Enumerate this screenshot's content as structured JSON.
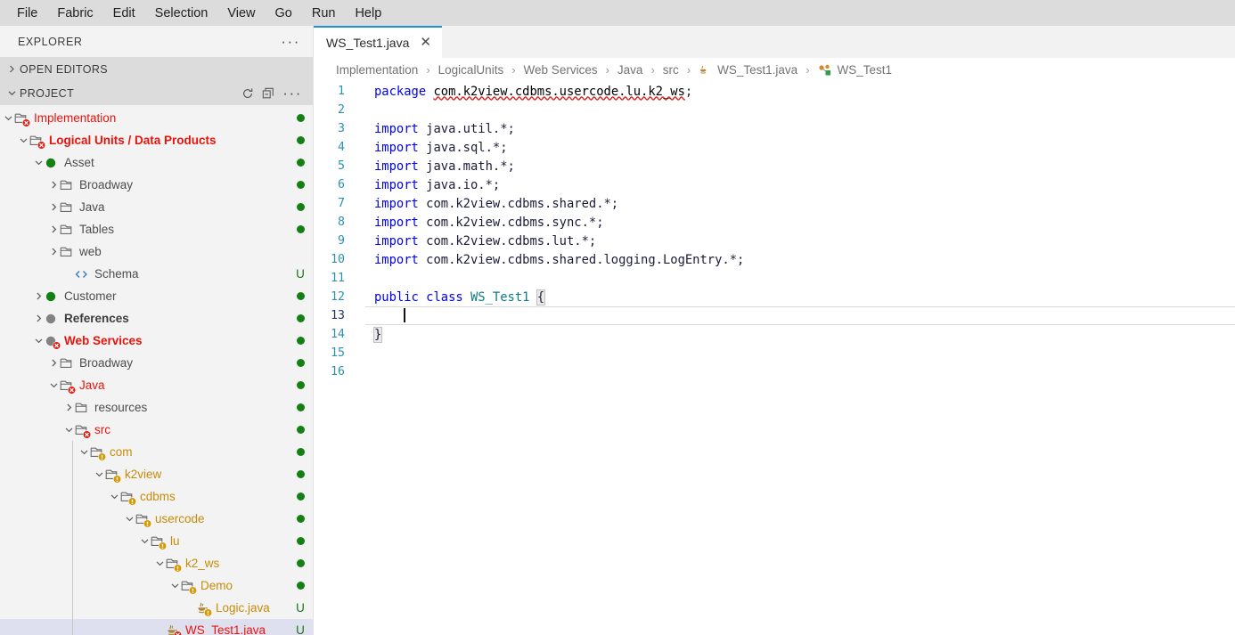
{
  "menubar": {
    "items": [
      {
        "label": "File"
      },
      {
        "label": "Fabric"
      },
      {
        "label": "Edit"
      },
      {
        "label": "Selection"
      },
      {
        "label": "View"
      },
      {
        "label": "Go"
      },
      {
        "label": "Run"
      },
      {
        "label": "Help"
      }
    ]
  },
  "sidebar": {
    "title": "EXPLORER",
    "more_icon": "···",
    "sections": [
      {
        "label": "OPEN EDITORS",
        "expanded": false,
        "twisty": "chevron-right-icon"
      },
      {
        "label": "PROJECT",
        "expanded": true,
        "twisty": "chevron-down-icon"
      }
    ],
    "project_actions": [
      {
        "name": "refresh-icon"
      },
      {
        "name": "collapse-all-icon"
      },
      {
        "name": "more-actions-icon",
        "label": "···"
      }
    ],
    "tree": [
      {
        "label": "Implementation",
        "depth": 0,
        "twisty": "down",
        "icon": "folder",
        "badge": "error",
        "style": "red",
        "status": "dot",
        "selected": false
      },
      {
        "label": "Logical Units / Data Products",
        "depth": 1,
        "twisty": "down",
        "icon": "folder",
        "badge": "error",
        "style": "redbold",
        "status": "dot",
        "selected": false
      },
      {
        "label": "Asset",
        "depth": 2,
        "twisty": "down",
        "icon": "circle-green",
        "badge": "none",
        "style": "plain",
        "status": "dot",
        "selected": false
      },
      {
        "label": "Broadway",
        "depth": 3,
        "twisty": "right",
        "icon": "folder",
        "badge": "none",
        "style": "plain",
        "status": "dot",
        "selected": false
      },
      {
        "label": "Java",
        "depth": 3,
        "twisty": "right",
        "icon": "folder",
        "badge": "none",
        "style": "plain",
        "status": "dot",
        "selected": false
      },
      {
        "label": "Tables",
        "depth": 3,
        "twisty": "right",
        "icon": "folder",
        "badge": "none",
        "style": "plain",
        "status": "dot",
        "selected": false
      },
      {
        "label": "web",
        "depth": 3,
        "twisty": "right",
        "icon": "folder",
        "badge": "none",
        "style": "plain",
        "status": "none",
        "selected": false
      },
      {
        "label": "Schema",
        "depth": 4,
        "twisty": "none",
        "icon": "code",
        "badge": "none",
        "style": "plain",
        "status": "u",
        "selected": false
      },
      {
        "label": "Customer",
        "depth": 2,
        "twisty": "right",
        "icon": "circle-green",
        "badge": "none",
        "style": "plain",
        "status": "dot",
        "selected": false
      },
      {
        "label": "References",
        "depth": 2,
        "twisty": "right",
        "icon": "circle-gray",
        "badge": "none",
        "style": "bold",
        "status": "dot",
        "selected": false
      },
      {
        "label": "Web Services",
        "depth": 2,
        "twisty": "down",
        "icon": "circle-gray",
        "badge": "error",
        "style": "redbold",
        "status": "dot",
        "selected": false
      },
      {
        "label": "Broadway",
        "depth": 3,
        "twisty": "right",
        "icon": "folder",
        "badge": "none",
        "style": "plain",
        "status": "dot",
        "selected": false
      },
      {
        "label": "Java",
        "depth": 3,
        "twisty": "down",
        "icon": "folder",
        "badge": "error",
        "style": "red",
        "status": "dot",
        "selected": false
      },
      {
        "label": "resources",
        "depth": 4,
        "twisty": "right",
        "icon": "folder",
        "badge": "none",
        "style": "plain",
        "status": "dot",
        "selected": false
      },
      {
        "label": "src",
        "depth": 4,
        "twisty": "down",
        "icon": "folder",
        "badge": "error",
        "style": "red",
        "status": "dot",
        "selected": false
      },
      {
        "label": "com",
        "depth": 5,
        "twisty": "down",
        "icon": "folder",
        "badge": "warn",
        "style": "orange",
        "status": "dot",
        "selected": false
      },
      {
        "label": "k2view",
        "depth": 6,
        "twisty": "down",
        "icon": "folder",
        "badge": "warn",
        "style": "orange",
        "status": "dot",
        "selected": false
      },
      {
        "label": "cdbms",
        "depth": 7,
        "twisty": "down",
        "icon": "folder",
        "badge": "warn",
        "style": "orange",
        "status": "dot",
        "selected": false
      },
      {
        "label": "usercode",
        "depth": 8,
        "twisty": "down",
        "icon": "folder",
        "badge": "warn",
        "style": "orange",
        "status": "dot",
        "selected": false
      },
      {
        "label": "lu",
        "depth": 9,
        "twisty": "down",
        "icon": "folder",
        "badge": "warn",
        "style": "orange",
        "status": "dot",
        "selected": false
      },
      {
        "label": "k2_ws",
        "depth": 10,
        "twisty": "down",
        "icon": "folder",
        "badge": "warn",
        "style": "orange",
        "status": "dot",
        "selected": false
      },
      {
        "label": "Demo",
        "depth": 11,
        "twisty": "down",
        "icon": "folder",
        "badge": "warn",
        "style": "orange",
        "status": "dot",
        "selected": false
      },
      {
        "label": "Logic.java",
        "depth": 12,
        "twisty": "none",
        "icon": "java",
        "badge": "warn",
        "style": "orange",
        "status": "u",
        "selected": false
      },
      {
        "label": "WS_Test1.java",
        "depth": 10,
        "twisty": "none",
        "icon": "java",
        "badge": "error",
        "style": "red",
        "status": "u",
        "selected": true
      }
    ]
  },
  "editor": {
    "tabs": [
      {
        "label": "WS_Test1.java",
        "active": true,
        "close_icon": "close-icon",
        "close_glyph": "✕"
      }
    ],
    "breadcrumb": [
      {
        "label": "Implementation",
        "icon": "none"
      },
      {
        "label": "LogicalUnits",
        "icon": "none"
      },
      {
        "label": "Web Services",
        "icon": "none"
      },
      {
        "label": "Java",
        "icon": "none"
      },
      {
        "label": "src",
        "icon": "none"
      },
      {
        "label": "WS_Test1.java",
        "icon": "java-file-icon"
      },
      {
        "label": "WS_Test1",
        "icon": "class-symbol-icon"
      }
    ],
    "breadcrumb_separator": "›",
    "active_line": 13,
    "lines": [
      {
        "n": 1,
        "tokens": [
          {
            "t": "package",
            "c": "kw"
          },
          {
            "t": " ",
            "c": "plain"
          },
          {
            "t": "com.k2view.cdbms.usercode.lu.k2_ws",
            "c": "squig"
          },
          {
            "t": ";",
            "c": "ident"
          }
        ]
      },
      {
        "n": 2,
        "tokens": []
      },
      {
        "n": 3,
        "tokens": [
          {
            "t": "import",
            "c": "kw"
          },
          {
            "t": " java.util.*;",
            "c": "ident"
          }
        ]
      },
      {
        "n": 4,
        "tokens": [
          {
            "t": "import",
            "c": "kw"
          },
          {
            "t": " java.sql.*;",
            "c": "ident"
          }
        ]
      },
      {
        "n": 5,
        "tokens": [
          {
            "t": "import",
            "c": "kw"
          },
          {
            "t": " java.math.*;",
            "c": "ident"
          }
        ]
      },
      {
        "n": 6,
        "tokens": [
          {
            "t": "import",
            "c": "kw"
          },
          {
            "t": " java.io.*;",
            "c": "ident"
          }
        ]
      },
      {
        "n": 7,
        "tokens": [
          {
            "t": "import",
            "c": "kw"
          },
          {
            "t": " com.k2view.cdbms.shared.*;",
            "c": "ident"
          }
        ]
      },
      {
        "n": 8,
        "tokens": [
          {
            "t": "import",
            "c": "kw"
          },
          {
            "t": " com.k2view.cdbms.sync.*;",
            "c": "ident"
          }
        ]
      },
      {
        "n": 9,
        "tokens": [
          {
            "t": "import",
            "c": "kw"
          },
          {
            "t": " com.k2view.cdbms.lut.*;",
            "c": "ident"
          }
        ]
      },
      {
        "n": 10,
        "tokens": [
          {
            "t": "import",
            "c": "kw"
          },
          {
            "t": " com.k2view.cdbms.shared.logging.LogEntry.*;",
            "c": "ident"
          }
        ]
      },
      {
        "n": 11,
        "tokens": []
      },
      {
        "n": 12,
        "tokens": [
          {
            "t": "public class",
            "c": "kw"
          },
          {
            "t": " ",
            "c": "plain"
          },
          {
            "t": "WS_Test1",
            "c": "cls"
          },
          {
            "t": " ",
            "c": "plain"
          },
          {
            "t": "{",
            "c": "bracket"
          }
        ]
      },
      {
        "n": 13,
        "tokens": [
          {
            "t": "    ",
            "c": "plain"
          },
          {
            "t": "",
            "c": "caret"
          }
        ]
      },
      {
        "n": 14,
        "tokens": [
          {
            "t": "}",
            "c": "bracket"
          }
        ]
      },
      {
        "n": 15,
        "tokens": []
      },
      {
        "n": 16,
        "tokens": []
      }
    ]
  },
  "colors": {
    "accent": "#2090d3",
    "error": "#e8140c",
    "warning": "#c78b08",
    "ok": "#128012",
    "selection": "#dee0f0",
    "menubar_bg": "#dcdcdc"
  }
}
